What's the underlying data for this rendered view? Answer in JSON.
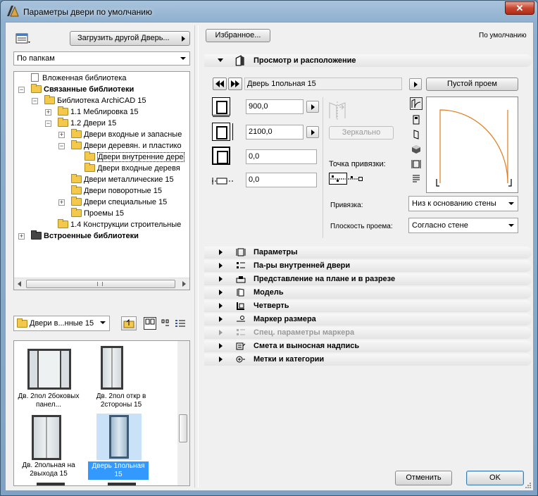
{
  "window": {
    "title": "Параметры двери по умолчанию",
    "close_glyph": "✕"
  },
  "left": {
    "load_button": "Загрузить другой Дверь...",
    "view_mode": "По папкам",
    "tree": [
      {
        "label": "Вложенная библиотека",
        "bold": false
      },
      {
        "label": "Связанные библиотеки",
        "bold": true
      },
      {
        "label": "Библиотека ArchiCAD 15",
        "bold": false
      },
      {
        "label": "1.1 Меблировка 15",
        "bold": false
      },
      {
        "label": "1.2 Двери 15",
        "bold": false
      },
      {
        "label": "Двери входные и запасные",
        "bold": false
      },
      {
        "label": "Двери деревян. и пластико",
        "bold": false
      },
      {
        "label": "Двери внутренние дере",
        "bold": false
      },
      {
        "label": "Двери входные деревя",
        "bold": false
      },
      {
        "label": "Двери металлические 15",
        "bold": false
      },
      {
        "label": "Двери поворотные 15",
        "bold": false
      },
      {
        "label": "Двери специальные 15",
        "bold": false
      },
      {
        "label": "Проемы 15",
        "bold": false
      },
      {
        "label": "1.4 Конструкции строительные",
        "bold": false
      },
      {
        "label": "Встроенные библиотеки",
        "bold": true
      }
    ],
    "folder_select": "Двери в...нные 15",
    "thumbnails": [
      {
        "label": "Дв. 2пол 2боковых панел...",
        "selected": false
      },
      {
        "label": "Дв. 2пол откр в 2стороны 15",
        "selected": false
      },
      {
        "label": "Дв. 2польная на 2выхода 15",
        "selected": false
      },
      {
        "label": "Дверь 1польная 15",
        "selected": true
      }
    ]
  },
  "right": {
    "favorites_button": "Избранное...",
    "defaults_label": "По умолчанию",
    "main_section": "Просмотр и расположение",
    "object_name": "Дверь 1польная 15",
    "empty_opening_button": "Пустой проем",
    "width": "900,0",
    "height": "2100,0",
    "field3": "0,0",
    "field4": "0,0",
    "mirror_button": "Зеркально",
    "anchor_point_label": "Точка привязки:",
    "anchor_label": "Привязка:",
    "anchor_value": "Низ к основанию стены",
    "plane_label": "Плоскость проема:",
    "plane_value": "Согласно стене",
    "sections": [
      {
        "label": "Параметры",
        "disabled": false,
        "icon": "parameters-icon"
      },
      {
        "label": "Па-ры внутренней двери",
        "disabled": false,
        "icon": "inner-door-params-icon"
      },
      {
        "label": "Представление на плане и в разрезе",
        "disabled": false,
        "icon": "plan-section-icon"
      },
      {
        "label": "Модель",
        "disabled": false,
        "icon": "model-icon"
      },
      {
        "label": "Четверть",
        "disabled": false,
        "icon": "rebate-icon"
      },
      {
        "label": "Маркер размера",
        "disabled": false,
        "icon": "dimension-marker-icon"
      },
      {
        "label": "Спец. параметры маркера",
        "disabled": true,
        "icon": "marker-params-icon"
      },
      {
        "label": "Смета и выносная надпись",
        "disabled": false,
        "icon": "listing-label-icon"
      },
      {
        "label": "Метки и категории",
        "disabled": false,
        "icon": "tags-categories-icon"
      }
    ],
    "cancel_button": "Отменить",
    "ok_button": "OK"
  },
  "colors": {
    "arc": "#e07b1f",
    "selection": "#3399ff"
  }
}
